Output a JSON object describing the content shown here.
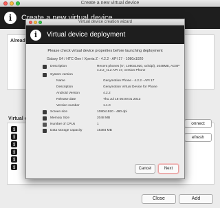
{
  "back_window": {
    "title": "Create a new virtual device",
    "header_title": "Create a new virtual device",
    "already_label": "Already",
    "virtual_label": "Virtual d",
    "side_buttons": [
      "onnect",
      "efresh"
    ],
    "bottom_buttons": [
      "Close",
      "Add"
    ]
  },
  "wizard": {
    "title": "Virtual device creation wizard",
    "header_title": "Virtual device deployment",
    "instruction": "Please check virtual device properties before launching deployment",
    "summary": "Galaxy S4 / HTC One / Xperia Z - 4.2.2 - API 17 - 1080x1920",
    "properties": [
      {
        "icon": "phone-icon",
        "label": "Description",
        "value": "Recent phones (5\", 1080x1920, xxhdpi), 2048MB, AOSP 4.2.2_r1.2 API 17, version Phone",
        "sub": false
      },
      {
        "icon": "system-icon",
        "label": "System version",
        "value": "",
        "sub": false
      },
      {
        "icon": "",
        "label": "Name",
        "value": "Genymotion Phone - 4.2.2 - API 17",
        "sub": true
      },
      {
        "icon": "",
        "label": "Description",
        "value": "Genymotion Virtual Device for Phone",
        "sub": true
      },
      {
        "icon": "",
        "label": "Android Version",
        "value": "4.2.2",
        "sub": true
      },
      {
        "icon": "",
        "label": "Release date",
        "value": "Thu Jul 18 05:00:01 2013",
        "sub": true
      },
      {
        "icon": "",
        "label": "Version number",
        "value": "1.1.0",
        "sub": true
      },
      {
        "icon": "screen-icon",
        "label": "Screen size",
        "value": "1080x1920 - 480 dpi",
        "sub": false
      },
      {
        "icon": "memory-icon",
        "label": "Memory Size",
        "value": "2048 MB",
        "sub": false
      },
      {
        "icon": "cpu-icon",
        "label": "Number of CPUs",
        "value": "1",
        "sub": false
      },
      {
        "icon": "storage-icon",
        "label": "Data storage capacity",
        "value": "16384 MB",
        "sub": false
      }
    ],
    "buttons": {
      "cancel": "Cancel",
      "next": "Next"
    }
  }
}
